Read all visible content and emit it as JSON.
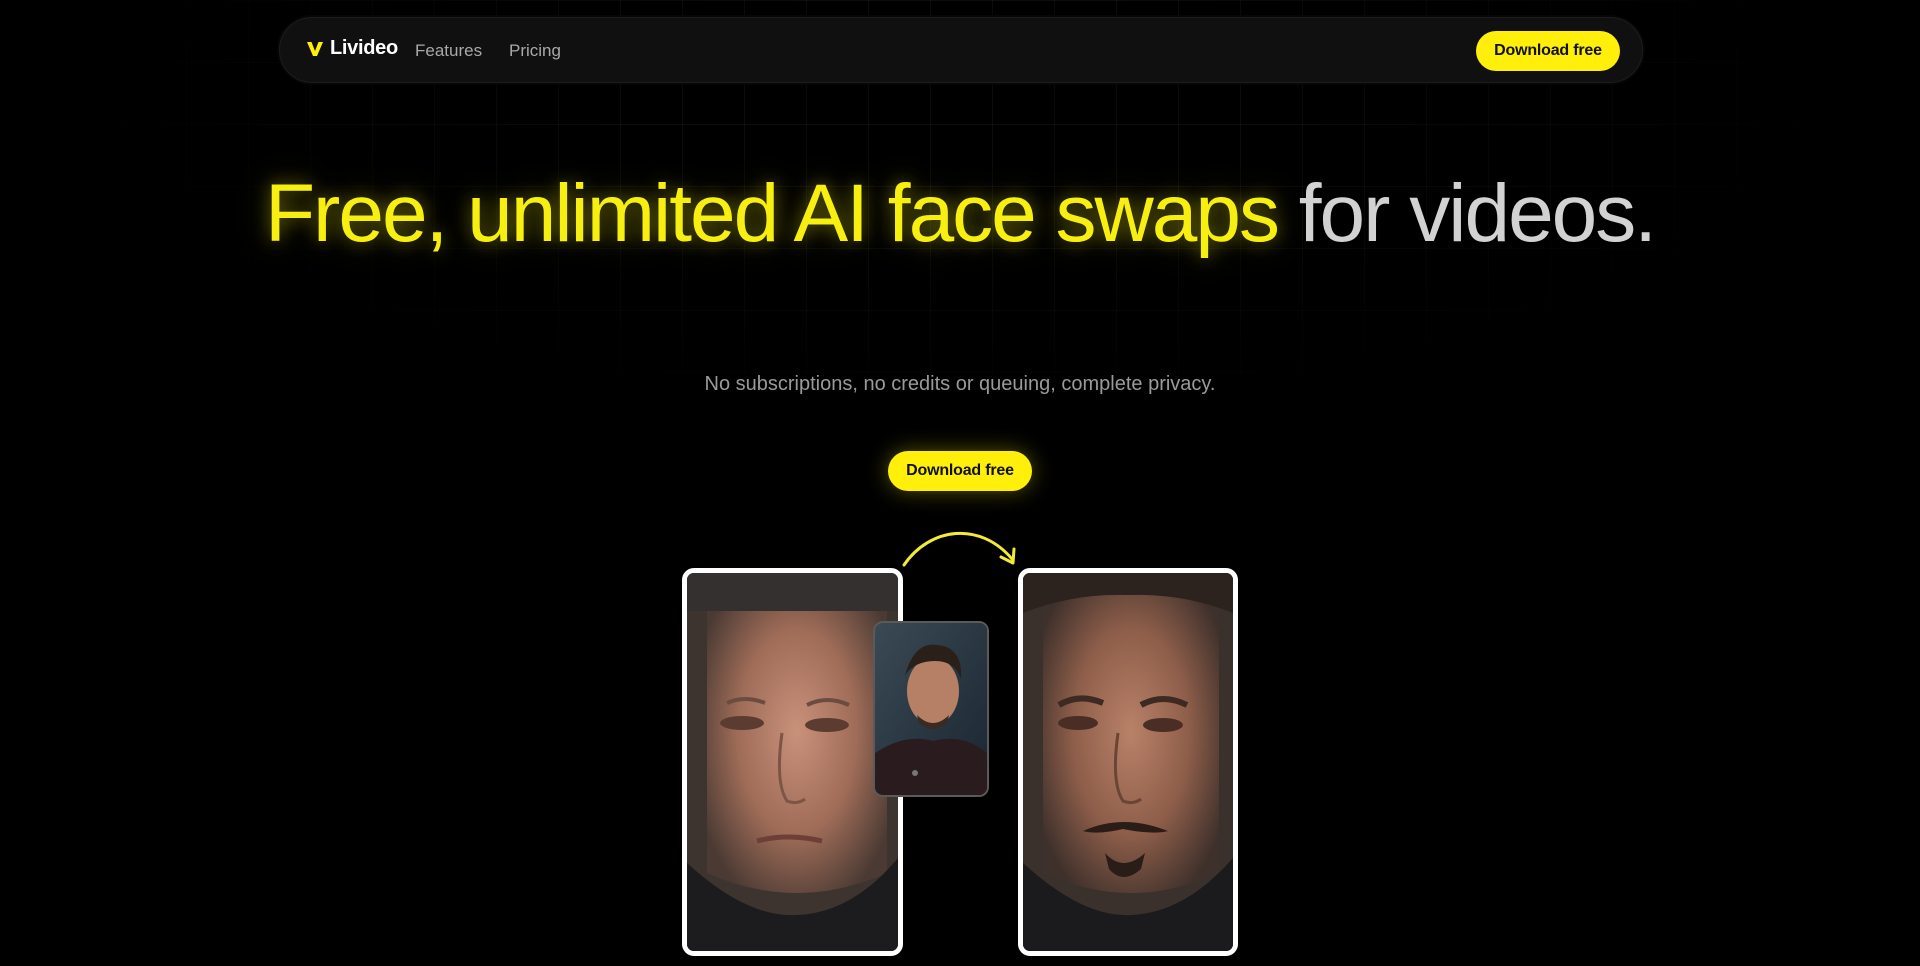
{
  "nav": {
    "logo_text": "Livideo",
    "links": [
      {
        "label": "Features"
      },
      {
        "label": "Pricing"
      }
    ],
    "download_label": "Download free"
  },
  "hero": {
    "title_highlight": "Free, unlimited AI face swaps",
    "title_rest": " for videos.",
    "subtitle": "No subscriptions, no credits or queuing, complete privacy.",
    "download_label": "Download free"
  },
  "colors": {
    "accent": "#ffef0a",
    "background": "#000000",
    "frame_border": "#ffffff"
  },
  "demo": {
    "source_image": "original-face-photo",
    "reference_image": "reference-face-photo",
    "result_image": "swapped-face-photo",
    "arrow_icon": "curved-arrow-icon"
  }
}
